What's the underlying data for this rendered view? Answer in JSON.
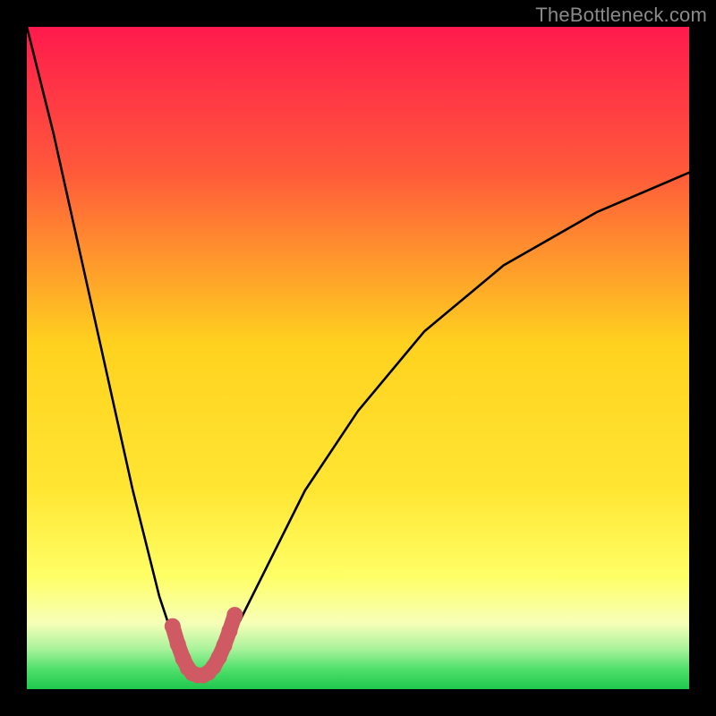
{
  "watermark": "TheBottleneck.com",
  "colors": {
    "background": "#000000",
    "gradient_top": "#ff1a4d",
    "gradient_mid1": "#ff6a2a",
    "gradient_mid2": "#ffd21f",
    "gradient_mid3": "#ffff66",
    "gradient_bottom_band": "#f7ffb8",
    "gradient_green1": "#a8f29a",
    "gradient_green2": "#4fe06a",
    "gradient_green3": "#1fc74e",
    "curve": "#000000",
    "marker": "#cf5a63"
  },
  "chart_data": {
    "type": "line",
    "title": "",
    "xlabel": "",
    "ylabel": "",
    "xlim": [
      0,
      100
    ],
    "ylim": [
      0,
      100
    ],
    "series": [
      {
        "name": "bottleneck-curve",
        "x": [
          0,
          4,
          8,
          12,
          16,
          20,
          22,
          24,
          25,
          26,
          27,
          28,
          29,
          30,
          32,
          36,
          42,
          50,
          60,
          72,
          86,
          100
        ],
        "y": [
          100,
          84,
          66,
          48,
          30,
          14,
          8,
          4,
          2.5,
          2,
          2,
          2.5,
          4,
          6,
          10,
          18,
          30,
          42,
          54,
          64,
          72,
          78
        ]
      }
    ],
    "markers": {
      "name": "bottom-u-markers",
      "x": [
        22.0,
        22.8,
        23.6,
        24.3,
        25.0,
        25.8,
        26.6,
        27.4,
        28.2,
        29.0,
        29.8,
        30.6,
        31.4
      ],
      "y": [
        9.5,
        6.8,
        4.6,
        3.2,
        2.4,
        2.1,
        2.1,
        2.5,
        3.4,
        4.8,
        6.6,
        8.8,
        11.2
      ]
    },
    "annotations": []
  }
}
